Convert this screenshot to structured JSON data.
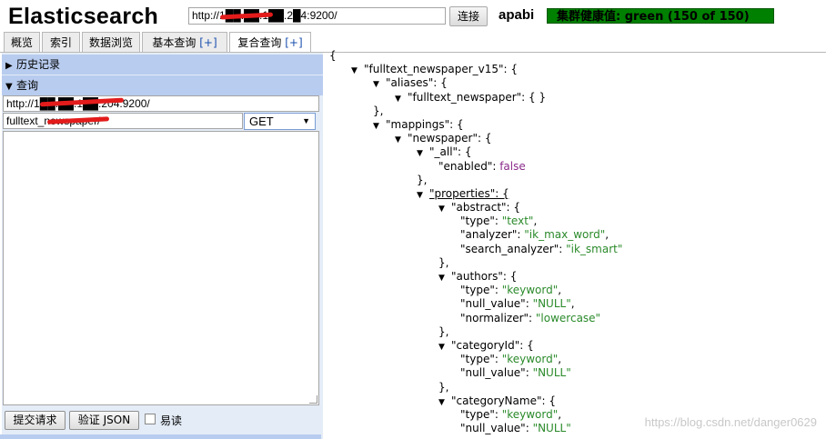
{
  "header": {
    "title": "Elasticsearch",
    "url_value": "http://1██.██.1██.2█4:9200/",
    "connect_label": "连接",
    "cluster_name": "apabi",
    "health_text": "集群健康值: green (150 of 150)"
  },
  "tabs": [
    {
      "label": "概览",
      "plus": ""
    },
    {
      "label": "索引",
      "plus": ""
    },
    {
      "label": "数据浏览",
      "plus": ""
    },
    {
      "label": "基本查询 ",
      "plus": "[+]"
    },
    {
      "label": "复合查询 ",
      "plus": "[+]"
    }
  ],
  "left_panel": {
    "history_label": "历史记录",
    "query_label": "查询",
    "server_url": "http://1██.██.1██.204:9200/",
    "path_value": "fulltext_newspaper/",
    "method": "GET",
    "submit_label": "提交请求",
    "validate_label": "验证 JSON",
    "readonly_label": "易读"
  },
  "colors": {
    "health": "#008000",
    "section_header": "#b8ccef",
    "string_value": "#2a8a2a",
    "boolean_value": "#8a2a8a"
  },
  "json_view": [
    {
      "t": "{"
    },
    {
      "i": 1,
      "tri": true,
      "t": "\"fulltext_newspaper_v15\": {"
    },
    {
      "i": 2,
      "tri": true,
      "t": "\"aliases\": {"
    },
    {
      "i": 3,
      "tri": true,
      "t": "\"fulltext_newspaper\": { }"
    },
    {
      "i": 2,
      "t": "},"
    },
    {
      "i": 2,
      "tri": true,
      "t": "\"mappings\": {"
    },
    {
      "i": 3,
      "tri": true,
      "t": "\"newspaper\": {"
    },
    {
      "i": 4,
      "tri": true,
      "t": "\"_all\": {"
    },
    {
      "i": 5,
      "k": "\"enabled\": ",
      "v": "false",
      "vt": "b"
    },
    {
      "i": 4,
      "t": "},"
    },
    {
      "i": 4,
      "tri": true,
      "ul": true,
      "t": "\"properties\": {"
    },
    {
      "i": 5,
      "tri": true,
      "t": "\"abstract\": {"
    },
    {
      "i": 6,
      "k": "\"type\": ",
      "v": "\"text\"",
      "vt": "s",
      "c": ","
    },
    {
      "i": 6,
      "k": "\"analyzer\": ",
      "v": "\"ik_max_word\"",
      "vt": "s",
      "c": ","
    },
    {
      "i": 6,
      "k": "\"search_analyzer\": ",
      "v": "\"ik_smart\"",
      "vt": "s"
    },
    {
      "i": 5,
      "t": "},"
    },
    {
      "i": 5,
      "tri": true,
      "t": "\"authors\": {"
    },
    {
      "i": 6,
      "k": "\"type\": ",
      "v": "\"keyword\"",
      "vt": "s",
      "c": ","
    },
    {
      "i": 6,
      "k": "\"null_value\": ",
      "v": "\"NULL\"",
      "vt": "s",
      "c": ","
    },
    {
      "i": 6,
      "k": "\"normalizer\": ",
      "v": "\"lowercase\"",
      "vt": "s"
    },
    {
      "i": 5,
      "t": "},"
    },
    {
      "i": 5,
      "tri": true,
      "t": "\"categoryId\": {"
    },
    {
      "i": 6,
      "k": "\"type\": ",
      "v": "\"keyword\"",
      "vt": "s",
      "c": ","
    },
    {
      "i": 6,
      "k": "\"null_value\": ",
      "v": "\"NULL\"",
      "vt": "s"
    },
    {
      "i": 5,
      "t": "},"
    },
    {
      "i": 5,
      "tri": true,
      "t": "\"categoryName\": {"
    },
    {
      "i": 6,
      "k": "\"type\": ",
      "v": "\"keyword\"",
      "vt": "s",
      "c": ","
    },
    {
      "i": 6,
      "k": "\"null_value\": ",
      "v": "\"NULL\"",
      "vt": "s"
    }
  ],
  "watermark": "https://blog.csdn.net/danger0629"
}
